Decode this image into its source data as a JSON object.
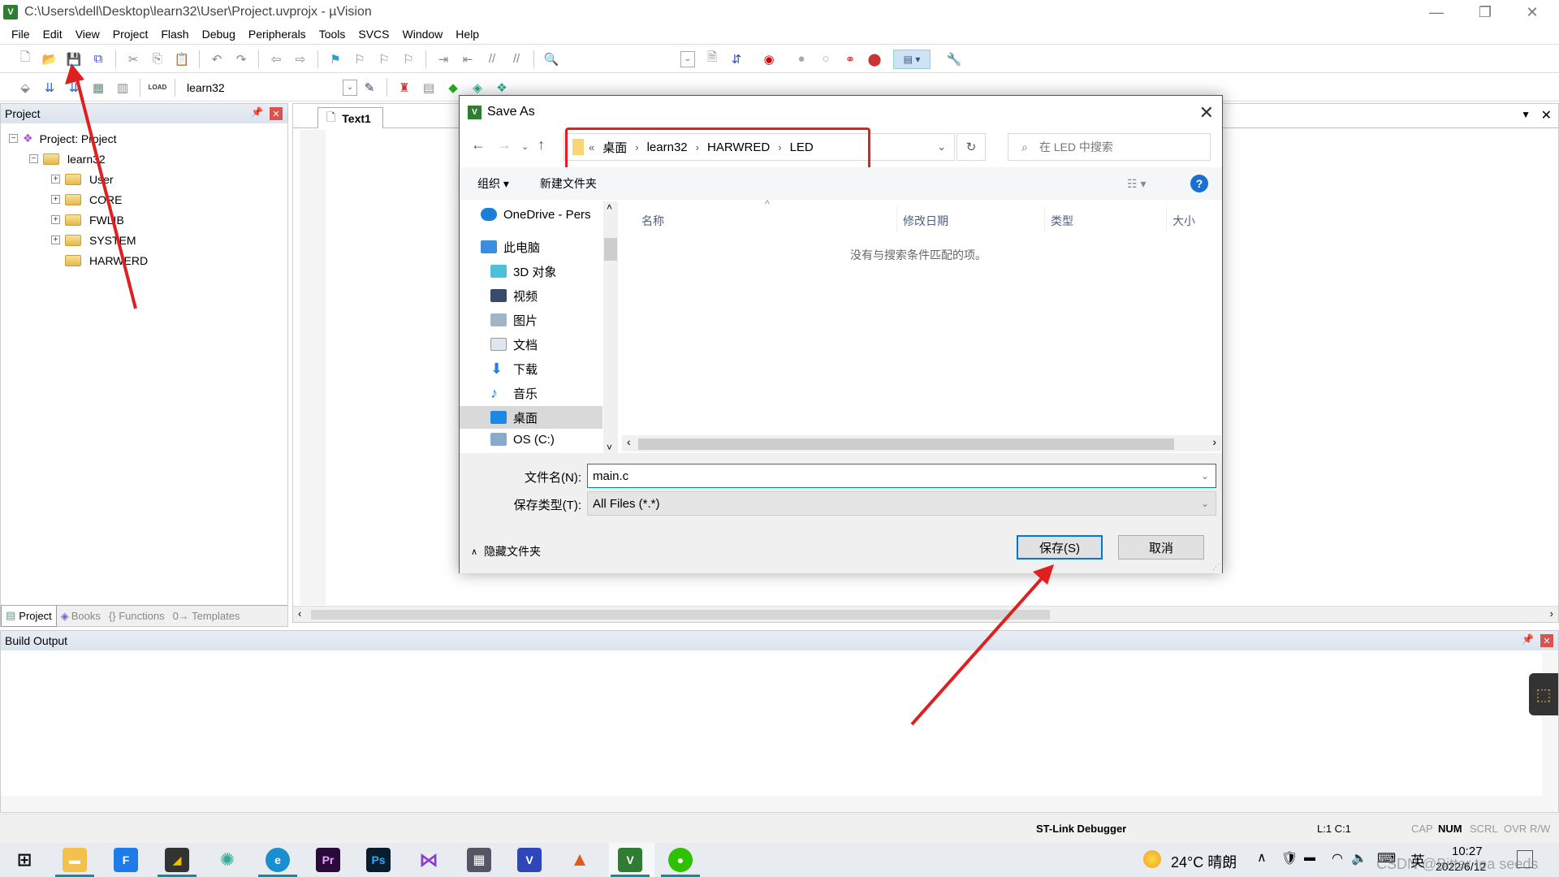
{
  "window": {
    "title": "C:\\Users\\dell\\Desktop\\learn32\\User\\Project.uvprojx - µVision",
    "app_icon": "uvision-icon",
    "controls": [
      "minimize",
      "restore",
      "close"
    ]
  },
  "menubar": [
    "File",
    "Edit",
    "View",
    "Project",
    "Flash",
    "Debug",
    "Peripherals",
    "Tools",
    "SVCS",
    "Window",
    "Help"
  ],
  "toolbar2": {
    "target": "learn32"
  },
  "project_panel": {
    "title": "Project",
    "tree": [
      {
        "label": "Project: Project",
        "level": 0,
        "expander": "−"
      },
      {
        "label": "learn32",
        "level": 1,
        "expander": "−"
      },
      {
        "label": "User",
        "level": 2,
        "expander": "+"
      },
      {
        "label": "CORE",
        "level": 2,
        "expander": "+"
      },
      {
        "label": "FWLIB",
        "level": 2,
        "expander": "+"
      },
      {
        "label": "SYSTEM",
        "level": 2,
        "expander": "+"
      },
      {
        "label": "HARWERD",
        "level": 2,
        "expander": ""
      }
    ],
    "tabs": [
      "Project",
      "Books",
      "{} Functions",
      "0→ Templates"
    ]
  },
  "editor": {
    "tab": "Text1"
  },
  "build_output": {
    "title": "Build Output"
  },
  "status_bar": {
    "debugger": "ST-Link Debugger",
    "position": "L:1 C:1",
    "indicators": [
      "CAP",
      "NUM",
      "SCRL",
      "OVR",
      "R/W"
    ]
  },
  "dialog": {
    "title": "Save As",
    "breadcrumb": [
      "«",
      "桌面",
      "learn32",
      "HARWRED",
      "LED"
    ],
    "search_placeholder": "在 LED 中搜索",
    "organize": "组织 ▾",
    "new_folder": "新建文件夹",
    "nav_items": [
      "OneDrive - Pers",
      "此电脑",
      "3D 对象",
      "视频",
      "图片",
      "文档",
      "下载",
      "音乐",
      "桌面",
      "OS (C:)"
    ],
    "selected_nav": "桌面",
    "columns": [
      "名称",
      "修改日期",
      "类型",
      "大小"
    ],
    "empty_message": "没有与搜索条件匹配的项。",
    "filename_label": "文件名(N):",
    "filename_value": "main.c",
    "filetype_label": "保存类型(T):",
    "filetype_value": "All Files (*.*)",
    "hide_folders": "隐藏文件夹",
    "save_button": "保存(S)",
    "cancel_button": "取消"
  },
  "taskbar": {
    "apps": [
      "start",
      "file-explorer",
      "fluent-f",
      "sticky-notes",
      "app-swirl",
      "edge",
      "Pr",
      "Ps",
      "visual-studio",
      "app-grid",
      "keil-uv4",
      "matlab",
      "keil-uv5",
      "wechat"
    ],
    "weather": "24°C 晴朗",
    "ime": "英",
    "time": "10:27",
    "date": "2022/6/12",
    "watermark": "CSDN @Bitter tea seeds"
  },
  "colors": {
    "highlight_red": "#e02020",
    "accent_blue": "#0078d7",
    "selected_nav": "#d9d9d9"
  }
}
